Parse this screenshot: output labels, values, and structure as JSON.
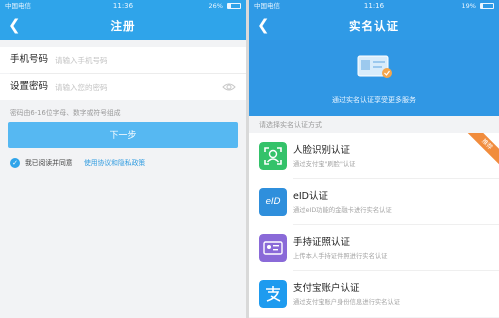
{
  "left": {
    "status": {
      "carrier": "中国电信",
      "time": "11:36",
      "battery": "26%",
      "battery_level": 0.26
    },
    "title": "注册",
    "fields": [
      {
        "label": "手机号码",
        "placeholder": "请输入手机号码"
      },
      {
        "label": "设置密码",
        "placeholder": "请输入您的密码"
      }
    ],
    "hint": "密码由6-16位字母、数字或符号组成",
    "next_button": "下一步",
    "agree_text": "我已阅读并同意",
    "agree_link": "使用协议和隐私政策"
  },
  "right": {
    "status": {
      "carrier": "中国电信",
      "time": "11:16",
      "battery": "19%",
      "battery_level": 0.19
    },
    "title": "实名认证",
    "banner_text": "通过实名认证享受更多服务",
    "section_label": "请选择实名认证方式",
    "methods": [
      {
        "title": "人脸识别认证",
        "subtitle": "通过支付宝\"刷脸\"认证",
        "badge": "推荐",
        "icon": "face-scan-icon",
        "color": "#34c26a"
      },
      {
        "title": "eID认证",
        "subtitle": "通过eID功能的金融卡进行实名认证",
        "icon_text": "eID",
        "icon": "eid-icon",
        "color": "#2f8fdc"
      },
      {
        "title": "手持证照认证",
        "subtitle": "上传本人手持证件照进行实名认证",
        "icon": "id-photo-icon",
        "color": "#8a6ad8"
      },
      {
        "title": "支付宝账户认证",
        "subtitle": "通过支付宝账户身份信息进行实名认证",
        "icon": "alipay-icon",
        "color": "#1e9bef"
      }
    ]
  },
  "colors": {
    "primary": "#2fa4ea",
    "button": "#56b8f2",
    "banner": "#3097e4",
    "badge": "#f18c3d"
  }
}
